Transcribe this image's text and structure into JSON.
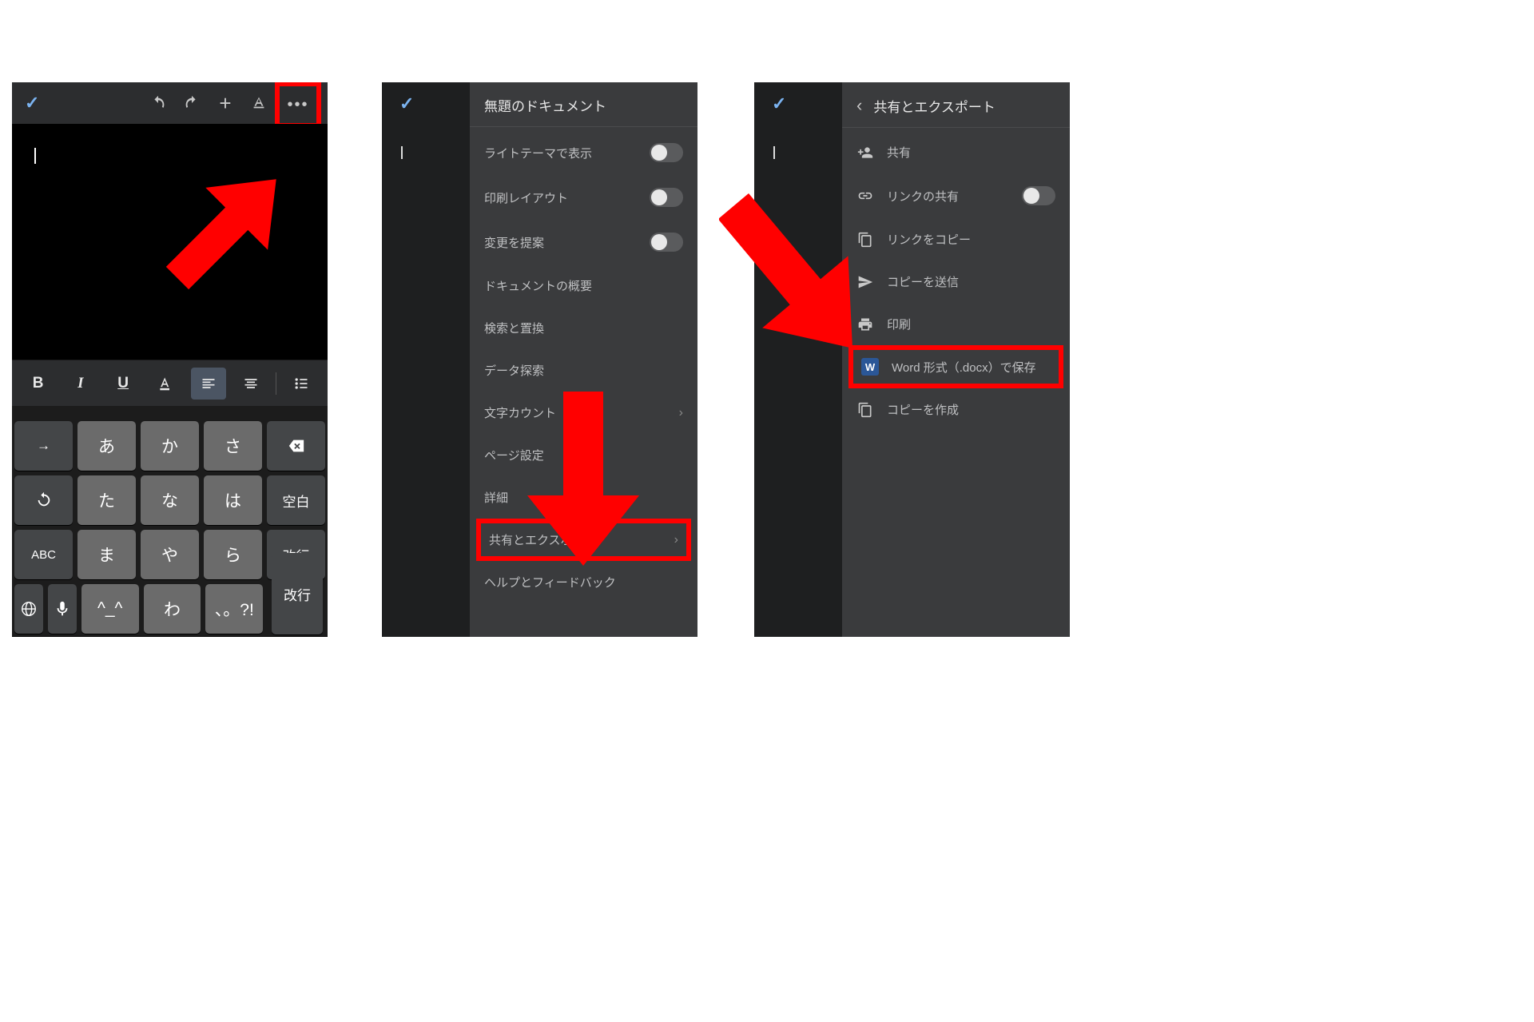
{
  "panel1": {
    "keyboard": {
      "row1": [
        "→",
        "あ",
        "か",
        "さ"
      ],
      "row2": [
        "た",
        "な",
        "は",
        "空白"
      ],
      "row3": [
        "ABC",
        "ま",
        "や",
        "ら",
        "改行"
      ],
      "row4": [
        "^_^",
        "わ",
        "、。?!"
      ]
    }
  },
  "panel2": {
    "title": "無題のドキュメント",
    "items": {
      "light_theme": "ライトテーマで表示",
      "print_layout": "印刷レイアウト",
      "suggest_changes": "変更を提案",
      "doc_outline": "ドキュメントの概要",
      "find_replace": "検索と置換",
      "explore": "データ探索",
      "word_count": "文字カウント",
      "page_setup": "ページ設定",
      "details": "詳細",
      "share_export": "共有とエクスポート",
      "help_feedback": "ヘルプとフィードバック"
    }
  },
  "panel3": {
    "title": "共有とエクスポート",
    "items": {
      "share": "共有",
      "link_sharing": "リンクの共有",
      "copy_link": "リンクをコピー",
      "send_copy": "コピーを送信",
      "print": "印刷",
      "save_word": "Word 形式（.docx）で保存",
      "make_copy": "コピーを作成"
    }
  }
}
